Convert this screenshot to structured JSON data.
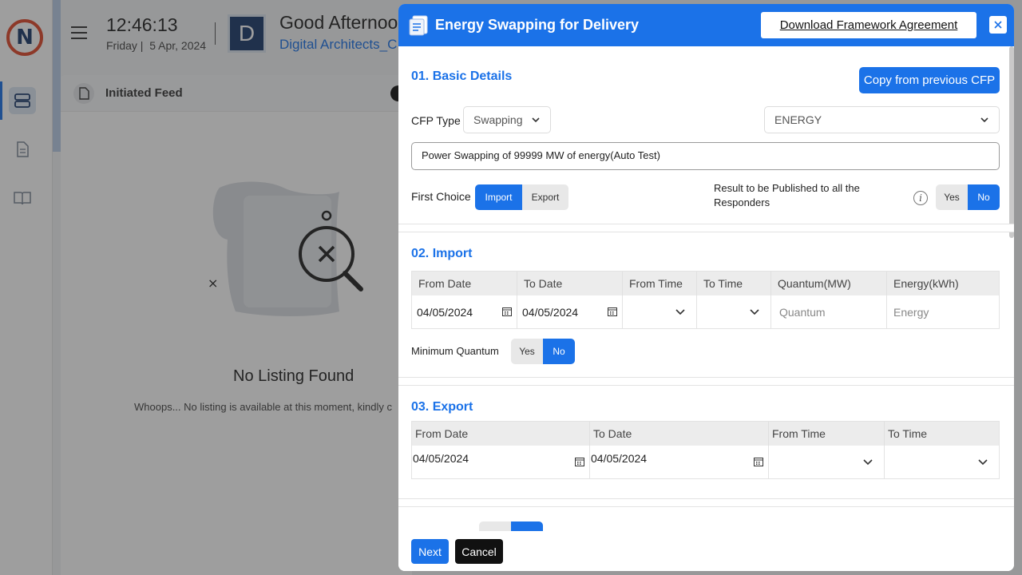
{
  "header": {
    "time": "12:46:13",
    "day": "Friday |",
    "date": "5 Apr, 2024",
    "avatar_letter": "D",
    "greeting": "Good Afternoo",
    "org": "Digital Architects_C"
  },
  "feed": {
    "title": "Initiated Feed",
    "empty_title": "No Listing Found",
    "empty_sub": "Whoops... No listing is available at this moment, kindly c"
  },
  "modal": {
    "title": "Energy Swapping for Delivery",
    "download_label": "Download Framework Agreement",
    "basic": {
      "title": "01. Basic Details",
      "copy_label": "Copy from previous CFP",
      "cfp_type_label": "CFP Type",
      "cfp_type_value": "Swapping",
      "commodity_value": "ENERGY",
      "description": "Power Swapping of 99999 MW of energy(Auto Test)",
      "first_choice_label": "First Choice",
      "first_choice_options": [
        "Import",
        "Export"
      ],
      "first_choice_selected": "Import",
      "publish_label": "Result to be Published to all the Responders",
      "publish_options": [
        "Yes",
        "No"
      ],
      "publish_selected": "No"
    },
    "import": {
      "title": "02. Import",
      "columns": [
        "From Date",
        "To Date",
        "From Time",
        "To Time",
        "Quantum(MW)",
        "Energy(kWh)"
      ],
      "from_date": "04/05/2024",
      "to_date": "04/05/2024",
      "quantum_placeholder": "Quantum",
      "energy_placeholder": "Energy",
      "min_quantum_label": "Minimum Quantum",
      "min_quantum_options": [
        "Yes",
        "No"
      ],
      "min_quantum_selected": "No"
    },
    "export": {
      "title": "03. Export",
      "columns": [
        "From Date",
        "To Date",
        "From Time",
        "To Time"
      ],
      "from_date": "04/05/2024",
      "to_date": "04/05/2024"
    },
    "footer": {
      "next_label": "Next",
      "cancel_label": "Cancel"
    }
  },
  "colors": {
    "accent": "#1b72e8",
    "overlay": "rgba(40,40,40,0.45)"
  },
  "icons": [
    "menu-icon",
    "feed-icon",
    "document-icon",
    "book-icon",
    "search-cross-icon",
    "close-icon",
    "chevron-down-icon",
    "calendar-icon",
    "info-icon",
    "swap-doc-icon"
  ]
}
